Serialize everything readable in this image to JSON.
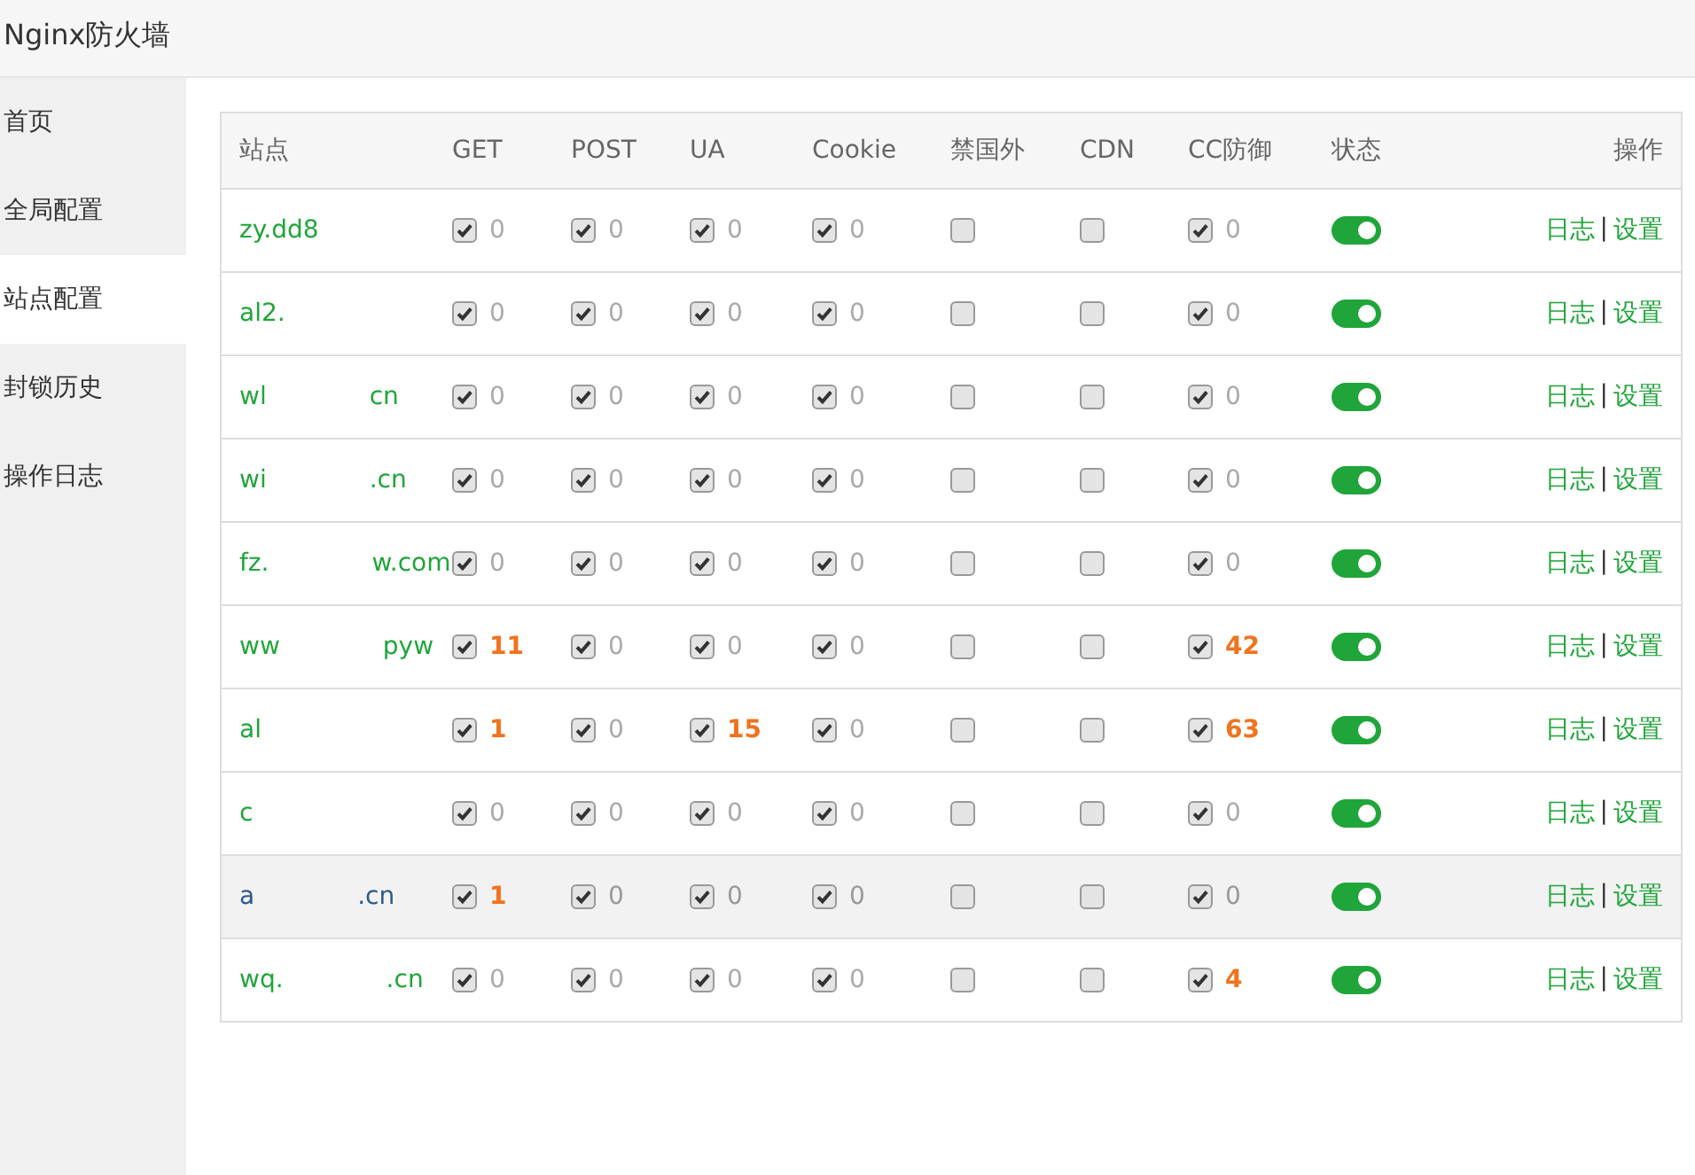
{
  "window": {
    "title": "Nginx防火墙"
  },
  "sidebar": {
    "items": [
      {
        "label": "首页",
        "selected": false
      },
      {
        "label": "全局配置",
        "selected": false
      },
      {
        "label": "站点配置",
        "selected": true
      },
      {
        "label": "封锁历史",
        "selected": false
      },
      {
        "label": "操作日志",
        "selected": false
      }
    ]
  },
  "table": {
    "columns": [
      "站点",
      "GET",
      "POST",
      "UA",
      "Cookie",
      "禁国外",
      "CDN",
      "CC防御",
      "状态",
      "操作"
    ],
    "rows": [
      {
        "site_start": "zy.dd8",
        "site_end": "",
        "highlighted": false,
        "checks": [
          {
            "checked": true,
            "count": "0"
          },
          {
            "checked": true,
            "count": "0"
          },
          {
            "checked": true,
            "count": "0"
          },
          {
            "checked": true,
            "count": "0"
          },
          {
            "checked": false
          },
          {
            "checked": false
          },
          {
            "checked": true,
            "count": "0"
          }
        ],
        "on": true,
        "actions": [
          "日志",
          "设置"
        ],
        "separator": "|"
      },
      {
        "site_start": "al2.",
        "site_end": "",
        "highlighted": false,
        "checks": [
          {
            "checked": true,
            "count": "0"
          },
          {
            "checked": true,
            "count": "0"
          },
          {
            "checked": true,
            "count": "0"
          },
          {
            "checked": true,
            "count": "0"
          },
          {
            "checked": false
          },
          {
            "checked": false
          },
          {
            "checked": true,
            "count": "0"
          }
        ],
        "on": true,
        "actions": [
          "日志",
          "设置"
        ],
        "separator": "|"
      },
      {
        "site_start": "wl",
        "site_end": "cn",
        "highlighted": false,
        "checks": [
          {
            "checked": true,
            "count": "0"
          },
          {
            "checked": true,
            "count": "0"
          },
          {
            "checked": true,
            "count": "0"
          },
          {
            "checked": true,
            "count": "0"
          },
          {
            "checked": false
          },
          {
            "checked": false
          },
          {
            "checked": true,
            "count": "0"
          }
        ],
        "on": true,
        "actions": [
          "日志",
          "设置"
        ],
        "separator": "|"
      },
      {
        "site_start": "wi",
        "site_end": ".cn",
        "highlighted": false,
        "checks": [
          {
            "checked": true,
            "count": "0"
          },
          {
            "checked": true,
            "count": "0"
          },
          {
            "checked": true,
            "count": "0"
          },
          {
            "checked": true,
            "count": "0"
          },
          {
            "checked": false
          },
          {
            "checked": false
          },
          {
            "checked": true,
            "count": "0"
          }
        ],
        "on": true,
        "actions": [
          "日志",
          "设置"
        ],
        "separator": "|"
      },
      {
        "site_start": "fz.",
        "site_end": "w.com",
        "highlighted": false,
        "checks": [
          {
            "checked": true,
            "count": "0"
          },
          {
            "checked": true,
            "count": "0"
          },
          {
            "checked": true,
            "count": "0"
          },
          {
            "checked": true,
            "count": "0"
          },
          {
            "checked": false
          },
          {
            "checked": false
          },
          {
            "checked": true,
            "count": "0"
          }
        ],
        "on": true,
        "actions": [
          "日志",
          "设置"
        ],
        "separator": "|"
      },
      {
        "site_start": "ww",
        "site_end": "pyw",
        "highlighted": false,
        "checks": [
          {
            "checked": true,
            "count": "11"
          },
          {
            "checked": true,
            "count": "0"
          },
          {
            "checked": true,
            "count": "0"
          },
          {
            "checked": true,
            "count": "0"
          },
          {
            "checked": false
          },
          {
            "checked": false
          },
          {
            "checked": true,
            "count": "42"
          }
        ],
        "on": true,
        "actions": [
          "日志",
          "设置"
        ],
        "separator": "|"
      },
      {
        "site_start": "al",
        "site_end": "",
        "highlighted": false,
        "checks": [
          {
            "checked": true,
            "count": "1"
          },
          {
            "checked": true,
            "count": "0"
          },
          {
            "checked": true,
            "count": "15"
          },
          {
            "checked": true,
            "count": "0"
          },
          {
            "checked": false
          },
          {
            "checked": false
          },
          {
            "checked": true,
            "count": "63"
          }
        ],
        "on": true,
        "actions": [
          "日志",
          "设置"
        ],
        "separator": "|"
      },
      {
        "site_start": "c",
        "site_end": "",
        "highlighted": false,
        "checks": [
          {
            "checked": true,
            "count": "0"
          },
          {
            "checked": true,
            "count": "0"
          },
          {
            "checked": true,
            "count": "0"
          },
          {
            "checked": true,
            "count": "0"
          },
          {
            "checked": false
          },
          {
            "checked": false
          },
          {
            "checked": true,
            "count": "0"
          }
        ],
        "on": true,
        "actions": [
          "日志",
          "设置"
        ],
        "separator": "|"
      },
      {
        "site_start": "a",
        "site_end": ".cn",
        "highlighted": true,
        "checks": [
          {
            "checked": true,
            "count": "1"
          },
          {
            "checked": true,
            "count": "0"
          },
          {
            "checked": true,
            "count": "0"
          },
          {
            "checked": true,
            "count": "0"
          },
          {
            "checked": false
          },
          {
            "checked": false
          },
          {
            "checked": true,
            "count": "0"
          }
        ],
        "on": true,
        "actions": [
          "日志",
          "设置"
        ],
        "separator": "|"
      },
      {
        "site_start": "wq.",
        "site_end": ".cn",
        "highlighted": false,
        "checks": [
          {
            "checked": true,
            "count": "0"
          },
          {
            "checked": true,
            "count": "0"
          },
          {
            "checked": true,
            "count": "0"
          },
          {
            "checked": true,
            "count": "0"
          },
          {
            "checked": false
          },
          {
            "checked": false
          },
          {
            "checked": true,
            "count": "4"
          }
        ],
        "on": true,
        "actions": [
          "日志",
          "设置"
        ],
        "separator": "|"
      }
    ]
  }
}
